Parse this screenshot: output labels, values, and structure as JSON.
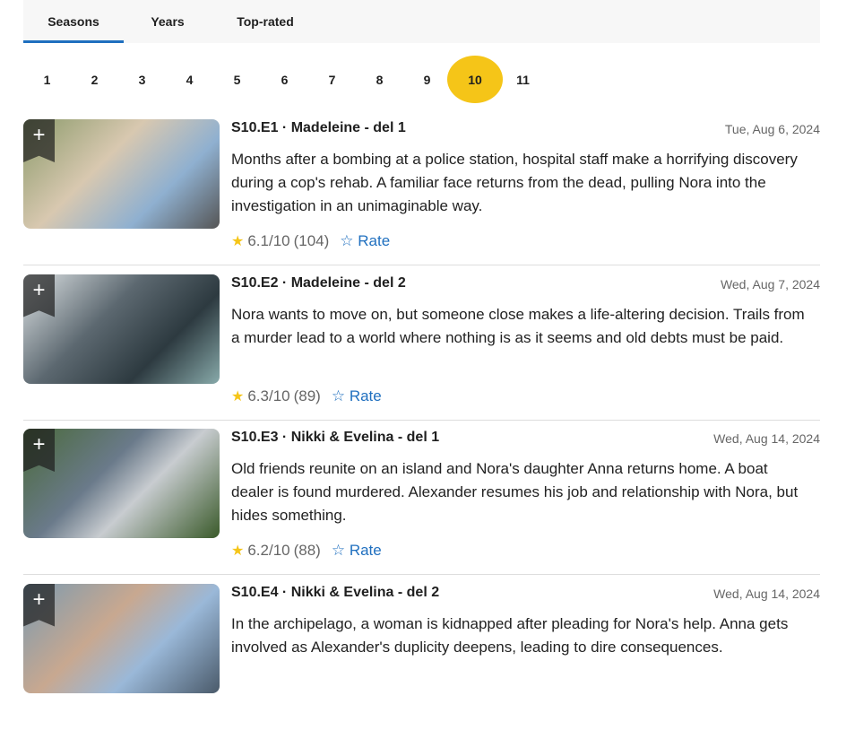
{
  "tabs": [
    "Seasons",
    "Years",
    "Top-rated"
  ],
  "seasons": [
    "1",
    "2",
    "3",
    "4",
    "5",
    "6",
    "7",
    "8",
    "9",
    "10",
    "11"
  ],
  "selected_season": "10",
  "rate_label": "Rate",
  "episodes": [
    {
      "title": "S10.E1 · Madeleine - del 1",
      "date": "Tue, Aug 6, 2024",
      "description": "Months after a bombing at a police station, hospital staff make a horrifying discovery during a cop's rehab. A familiar face returns from the dead, pulling Nora into the investigation in an unimaginable way.",
      "rating": "6.1/10",
      "votes": "(104)"
    },
    {
      "title": "S10.E2 · Madeleine - del 2",
      "date": "Wed, Aug 7, 2024",
      "description": "Nora wants to move on, but someone close makes a life-altering decision. Trails from a murder lead to a world where nothing is as it seems and old debts must be paid.",
      "rating": "6.3/10",
      "votes": "(89)"
    },
    {
      "title": "S10.E3 · Nikki & Evelina - del 1",
      "date": "Wed, Aug 14, 2024",
      "description": "Old friends reunite on an island and Nora's daughter Anna returns home. A boat dealer is found murdered. Alexander resumes his job and relationship with Nora, but hides something.",
      "rating": "6.2/10",
      "votes": "(88)"
    },
    {
      "title": "S10.E4 · Nikki & Evelina - del 2",
      "date": "Wed, Aug 14, 2024",
      "description": "In the archipelago, a woman is kidnapped after pleading for Nora's help. Anna gets involved as Alexander's duplicity deepens, leading to dire consequences.",
      "rating": "",
      "votes": ""
    }
  ]
}
